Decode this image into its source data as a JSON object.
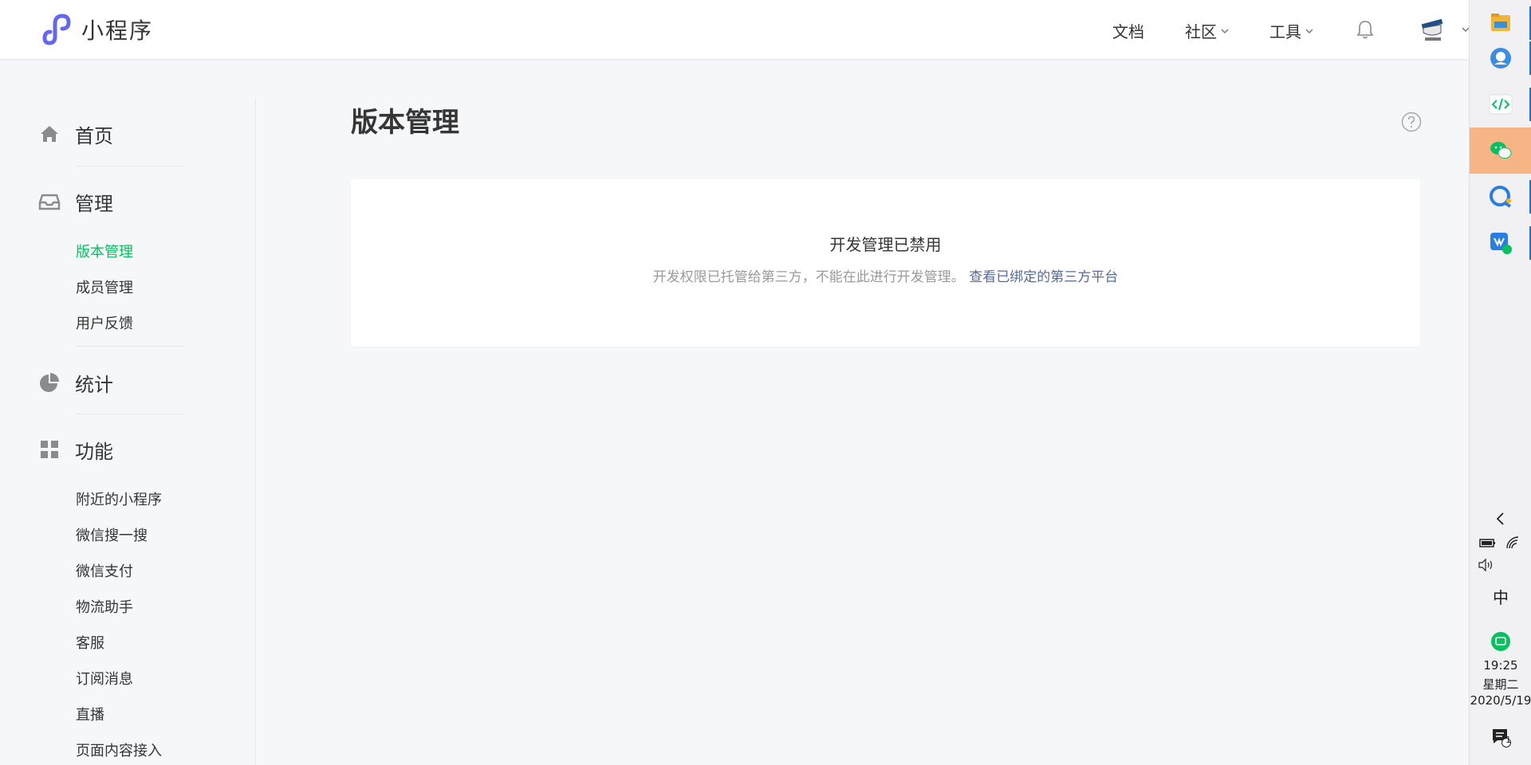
{
  "header": {
    "brand_name": "小程序",
    "nav": {
      "docs": "文档",
      "community": "社区",
      "tools": "工具"
    }
  },
  "sidebar": {
    "groups": [
      {
        "label": "首页",
        "icon": "home-icon"
      },
      {
        "label": "管理",
        "icon": "inbox-icon",
        "items": [
          "版本管理",
          "成员管理",
          "用户反馈"
        ]
      },
      {
        "label": "统计",
        "icon": "pie-chart-icon"
      },
      {
        "label": "功能",
        "icon": "grid-icon",
        "items": [
          "附近的小程序",
          "微信搜一搜",
          "微信支付",
          "物流助手",
          "客服",
          "订阅消息",
          "直播",
          "页面内容接入"
        ]
      }
    ],
    "active_item": "版本管理"
  },
  "main": {
    "title": "版本管理",
    "notice": {
      "title": "开发管理已禁用",
      "desc": "开发权限已托管给第三方，不能在此进行开发管理。",
      "link": "查看已绑定的第三方平台"
    }
  },
  "taskbar": {
    "apps": [
      "file-explorer-icon",
      "browser-icon",
      "devtools-icon",
      "wechat-icon",
      "chat-icon",
      "wechat-work-icon"
    ],
    "active_app": "wechat-icon",
    "tray": {
      "ime": "中",
      "time": "19:25",
      "weekday": "星期二",
      "date": "2020/5/19",
      "notifications": "1"
    }
  },
  "colors": {
    "accent": "#07c160",
    "link": "#576b95",
    "active_taskbar": "#f7b586"
  }
}
